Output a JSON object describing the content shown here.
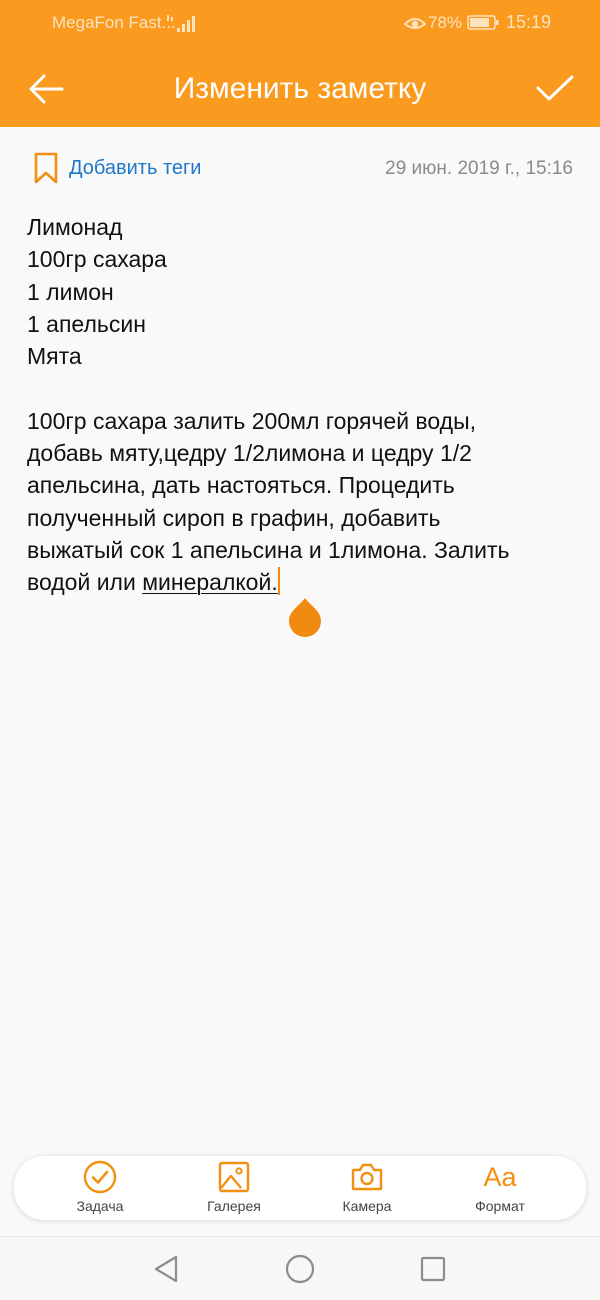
{
  "status_bar": {
    "carrier": "MegaFon Fast...",
    "battery_percent": "78%",
    "time": "15:19",
    "icons": [
      "signal-icon",
      "eye-comfort-icon",
      "battery-icon"
    ]
  },
  "header": {
    "title": "Изменить заметку",
    "back_icon": "arrow-left-icon",
    "confirm_icon": "checkmark-icon",
    "color": "#fa9a1e"
  },
  "meta": {
    "tag_icon": "bookmark-icon",
    "add_tags_label": "Добавить теги",
    "date": "29 июн. 2019 г., 15:16"
  },
  "note": {
    "lines": [
      "Лимонад",
      "100гр сахара",
      "1 лимон",
      "1 апельсин",
      "Мята",
      "",
      "100гр сахара залить 200мл горячей воды,",
      "добавь мяту,цедру 1/2лимона и цедру 1/2",
      "апельсина, дать настояться. Процедить",
      "полученный сироп в графин, добавить",
      "выжатый сок 1 апельсина и 1лимона. Залить"
    ],
    "last_line_prefix": "водой или ",
    "last_line_word": "минералкой."
  },
  "toolbar": {
    "items": [
      {
        "label": "Задача",
        "icon": "task-check-icon"
      },
      {
        "label": "Галерея",
        "icon": "gallery-icon"
      },
      {
        "label": "Камера",
        "icon": "camera-icon"
      },
      {
        "label": "Формат",
        "icon": "format-aa-icon",
        "glyph": "Aa"
      }
    ]
  },
  "nav_bar": {
    "icons": [
      "nav-back-icon",
      "nav-home-icon",
      "nav-recents-icon"
    ]
  },
  "colors": {
    "accent": "#fa9a1e",
    "link": "#1e78c8",
    "caret": "#f08a10"
  }
}
